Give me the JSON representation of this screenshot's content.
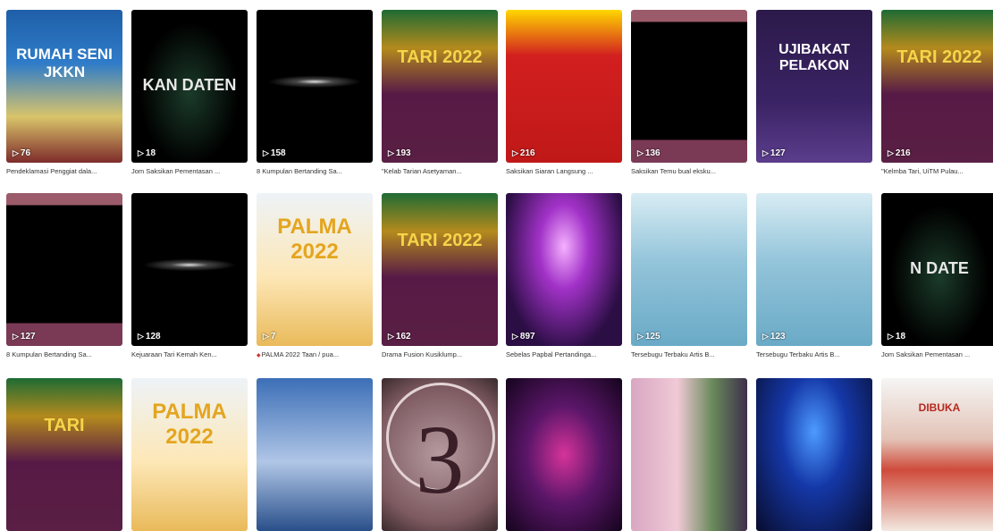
{
  "tiles": [
    {
      "views": "76",
      "caption": "Pendeklamasi Penggiat dala...",
      "style": "t-blue",
      "poster": "RUMAH SENI JKKN"
    },
    {
      "views": "18",
      "caption": "Jom Saksikan Pementasan ...",
      "style": "t-dark-lights",
      "poster": "KAN DATEN"
    },
    {
      "views": "158",
      "caption": "8 Kumpulan Bertanding Sa...",
      "style": "t-black-line",
      "poster": ""
    },
    {
      "views": "193",
      "caption": "\"Kelab Tarian Asetyaman...",
      "style": "t-tari",
      "poster": "TARI 2022"
    },
    {
      "views": "216",
      "caption": "Saksikan Siaran Langsung ...",
      "style": "t-red",
      "poster": ""
    },
    {
      "views": "136",
      "caption": "Saksikan Temu bual eksku...",
      "style": "t-blank",
      "poster": ""
    },
    {
      "views": "127",
      "caption": "",
      "style": "t-purple",
      "poster": "UJIBAKAT PELAKON"
    },
    {
      "views": "216",
      "caption": "\"Kelmba Tari, UiTM Pulau...",
      "style": "t-tari",
      "poster": "TARI 2022"
    },
    {
      "views": "127",
      "caption": "8 Kumpulan Bertanding Sa...",
      "style": "t-blank",
      "poster": ""
    },
    {
      "views": "128",
      "caption": "Kejuaraan Tari Kemah Ken...",
      "style": "t-black-line",
      "poster": ""
    },
    {
      "views": "7",
      "caption": "PALMA 2022 Taan / pua...",
      "style": "t-palma",
      "poster": "PALMA 2022",
      "pinned": true
    },
    {
      "views": "162",
      "caption": "Drama Fusion Kusiklump...",
      "style": "t-tari",
      "poster": "TARI 2022"
    },
    {
      "views": "897",
      "caption": "Sebelas Papbal Pertandinga...",
      "style": "t-stage",
      "poster": ""
    },
    {
      "views": "125",
      "caption": "Tersebugu Terbaku Artis B...",
      "style": "t-poster",
      "poster": ""
    },
    {
      "views": "123",
      "caption": "Tersebugu Terbaku Artis B...",
      "style": "t-poster",
      "poster": ""
    },
    {
      "views": "18",
      "caption": "Jom Saksikan Pementasan ...",
      "style": "t-dark-lights",
      "poster": "N DATE"
    },
    {
      "views": "",
      "caption": "",
      "style": "t-tari",
      "poster": "TARI"
    },
    {
      "views": "",
      "caption": "",
      "style": "t-palma",
      "poster": "PALMA 2022"
    },
    {
      "views": "",
      "caption": "",
      "style": "t-city",
      "poster": ""
    },
    {
      "views": "",
      "caption": "",
      "style": "t-countdown",
      "poster": "3"
    },
    {
      "views": "",
      "caption": "",
      "style": "t-concert",
      "poster": ""
    },
    {
      "views": "",
      "caption": "",
      "style": "t-portrait",
      "poster": ""
    },
    {
      "views": "",
      "caption": "",
      "style": "t-blue-stage",
      "poster": ""
    },
    {
      "views": "",
      "caption": "",
      "style": "t-announce",
      "poster": "DIBUKA"
    }
  ]
}
